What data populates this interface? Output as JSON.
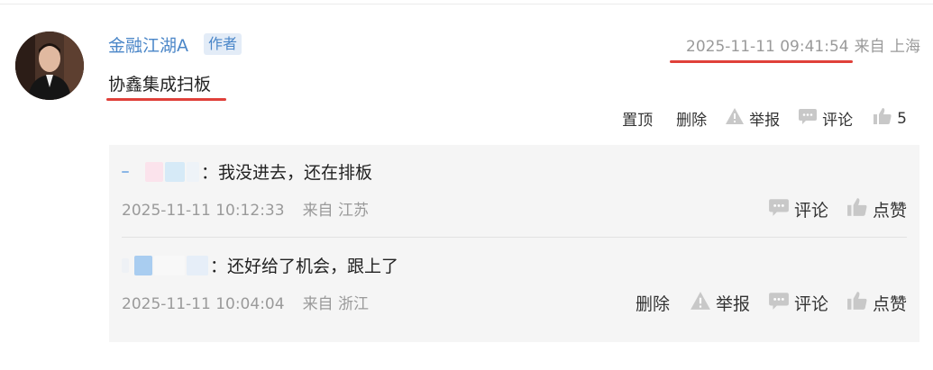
{
  "post": {
    "author": "金融江湖A",
    "badge": "作者",
    "timestamp": "2025-11-11 09:41:54",
    "location": "来自 上海",
    "content": "协鑫集成扫板",
    "actions": {
      "pin": "置顶",
      "delete": "删除",
      "report": "举报",
      "comment": "评论",
      "likes": "5"
    }
  },
  "replies": [
    {
      "text": "：我没进去，还在排板",
      "timestamp": "2025-11-11 10:12:33",
      "location": "来自 江苏",
      "actions": {
        "comment": "评论",
        "like": "点赞"
      }
    },
    {
      "text": "：还好给了机会，跟上了",
      "timestamp": "2025-11-11 10:04:04",
      "location": "来自 浙江",
      "actions": {
        "delete": "删除",
        "report": "举报",
        "comment": "评论",
        "like": "点赞"
      }
    }
  ],
  "colors": {
    "link": "#4a86c8",
    "underline": "#e0403a",
    "meta": "#9a9a9a",
    "panel": "#f5f5f5"
  }
}
